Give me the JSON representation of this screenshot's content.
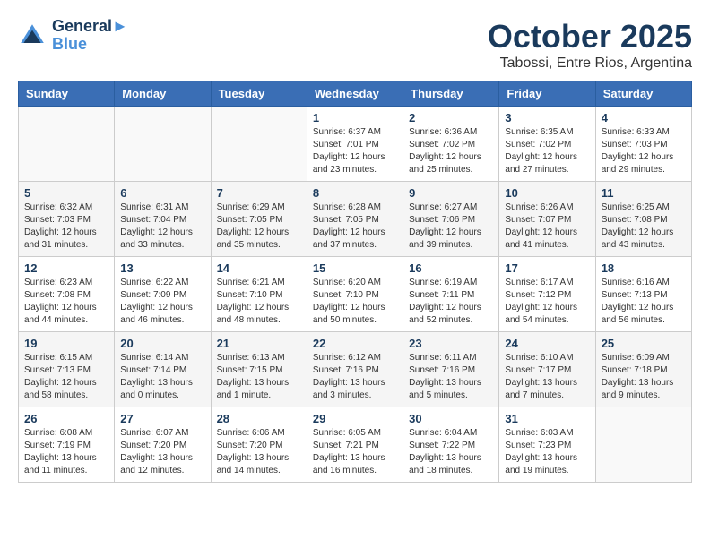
{
  "header": {
    "logo": {
      "line1": "General",
      "line2": "Blue"
    },
    "title": "October 2025",
    "subtitle": "Tabossi, Entre Rios, Argentina"
  },
  "calendar": {
    "days_of_week": [
      "Sunday",
      "Monday",
      "Tuesday",
      "Wednesday",
      "Thursday",
      "Friday",
      "Saturday"
    ],
    "weeks": [
      [
        {
          "day": "",
          "info": ""
        },
        {
          "day": "",
          "info": ""
        },
        {
          "day": "",
          "info": ""
        },
        {
          "day": "1",
          "info": "Sunrise: 6:37 AM\nSunset: 7:01 PM\nDaylight: 12 hours\nand 23 minutes."
        },
        {
          "day": "2",
          "info": "Sunrise: 6:36 AM\nSunset: 7:02 PM\nDaylight: 12 hours\nand 25 minutes."
        },
        {
          "day": "3",
          "info": "Sunrise: 6:35 AM\nSunset: 7:02 PM\nDaylight: 12 hours\nand 27 minutes."
        },
        {
          "day": "4",
          "info": "Sunrise: 6:33 AM\nSunset: 7:03 PM\nDaylight: 12 hours\nand 29 minutes."
        }
      ],
      [
        {
          "day": "5",
          "info": "Sunrise: 6:32 AM\nSunset: 7:03 PM\nDaylight: 12 hours\nand 31 minutes."
        },
        {
          "day": "6",
          "info": "Sunrise: 6:31 AM\nSunset: 7:04 PM\nDaylight: 12 hours\nand 33 minutes."
        },
        {
          "day": "7",
          "info": "Sunrise: 6:29 AM\nSunset: 7:05 PM\nDaylight: 12 hours\nand 35 minutes."
        },
        {
          "day": "8",
          "info": "Sunrise: 6:28 AM\nSunset: 7:05 PM\nDaylight: 12 hours\nand 37 minutes."
        },
        {
          "day": "9",
          "info": "Sunrise: 6:27 AM\nSunset: 7:06 PM\nDaylight: 12 hours\nand 39 minutes."
        },
        {
          "day": "10",
          "info": "Sunrise: 6:26 AM\nSunset: 7:07 PM\nDaylight: 12 hours\nand 41 minutes."
        },
        {
          "day": "11",
          "info": "Sunrise: 6:25 AM\nSunset: 7:08 PM\nDaylight: 12 hours\nand 43 minutes."
        }
      ],
      [
        {
          "day": "12",
          "info": "Sunrise: 6:23 AM\nSunset: 7:08 PM\nDaylight: 12 hours\nand 44 minutes."
        },
        {
          "day": "13",
          "info": "Sunrise: 6:22 AM\nSunset: 7:09 PM\nDaylight: 12 hours\nand 46 minutes."
        },
        {
          "day": "14",
          "info": "Sunrise: 6:21 AM\nSunset: 7:10 PM\nDaylight: 12 hours\nand 48 minutes."
        },
        {
          "day": "15",
          "info": "Sunrise: 6:20 AM\nSunset: 7:10 PM\nDaylight: 12 hours\nand 50 minutes."
        },
        {
          "day": "16",
          "info": "Sunrise: 6:19 AM\nSunset: 7:11 PM\nDaylight: 12 hours\nand 52 minutes."
        },
        {
          "day": "17",
          "info": "Sunrise: 6:17 AM\nSunset: 7:12 PM\nDaylight: 12 hours\nand 54 minutes."
        },
        {
          "day": "18",
          "info": "Sunrise: 6:16 AM\nSunset: 7:13 PM\nDaylight: 12 hours\nand 56 minutes."
        }
      ],
      [
        {
          "day": "19",
          "info": "Sunrise: 6:15 AM\nSunset: 7:13 PM\nDaylight: 12 hours\nand 58 minutes."
        },
        {
          "day": "20",
          "info": "Sunrise: 6:14 AM\nSunset: 7:14 PM\nDaylight: 13 hours\nand 0 minutes."
        },
        {
          "day": "21",
          "info": "Sunrise: 6:13 AM\nSunset: 7:15 PM\nDaylight: 13 hours\nand 1 minute."
        },
        {
          "day": "22",
          "info": "Sunrise: 6:12 AM\nSunset: 7:16 PM\nDaylight: 13 hours\nand 3 minutes."
        },
        {
          "day": "23",
          "info": "Sunrise: 6:11 AM\nSunset: 7:16 PM\nDaylight: 13 hours\nand 5 minutes."
        },
        {
          "day": "24",
          "info": "Sunrise: 6:10 AM\nSunset: 7:17 PM\nDaylight: 13 hours\nand 7 minutes."
        },
        {
          "day": "25",
          "info": "Sunrise: 6:09 AM\nSunset: 7:18 PM\nDaylight: 13 hours\nand 9 minutes."
        }
      ],
      [
        {
          "day": "26",
          "info": "Sunrise: 6:08 AM\nSunset: 7:19 PM\nDaylight: 13 hours\nand 11 minutes."
        },
        {
          "day": "27",
          "info": "Sunrise: 6:07 AM\nSunset: 7:20 PM\nDaylight: 13 hours\nand 12 minutes."
        },
        {
          "day": "28",
          "info": "Sunrise: 6:06 AM\nSunset: 7:20 PM\nDaylight: 13 hours\nand 14 minutes."
        },
        {
          "day": "29",
          "info": "Sunrise: 6:05 AM\nSunset: 7:21 PM\nDaylight: 13 hours\nand 16 minutes."
        },
        {
          "day": "30",
          "info": "Sunrise: 6:04 AM\nSunset: 7:22 PM\nDaylight: 13 hours\nand 18 minutes."
        },
        {
          "day": "31",
          "info": "Sunrise: 6:03 AM\nSunset: 7:23 PM\nDaylight: 13 hours\nand 19 minutes."
        },
        {
          "day": "",
          "info": ""
        }
      ]
    ]
  }
}
